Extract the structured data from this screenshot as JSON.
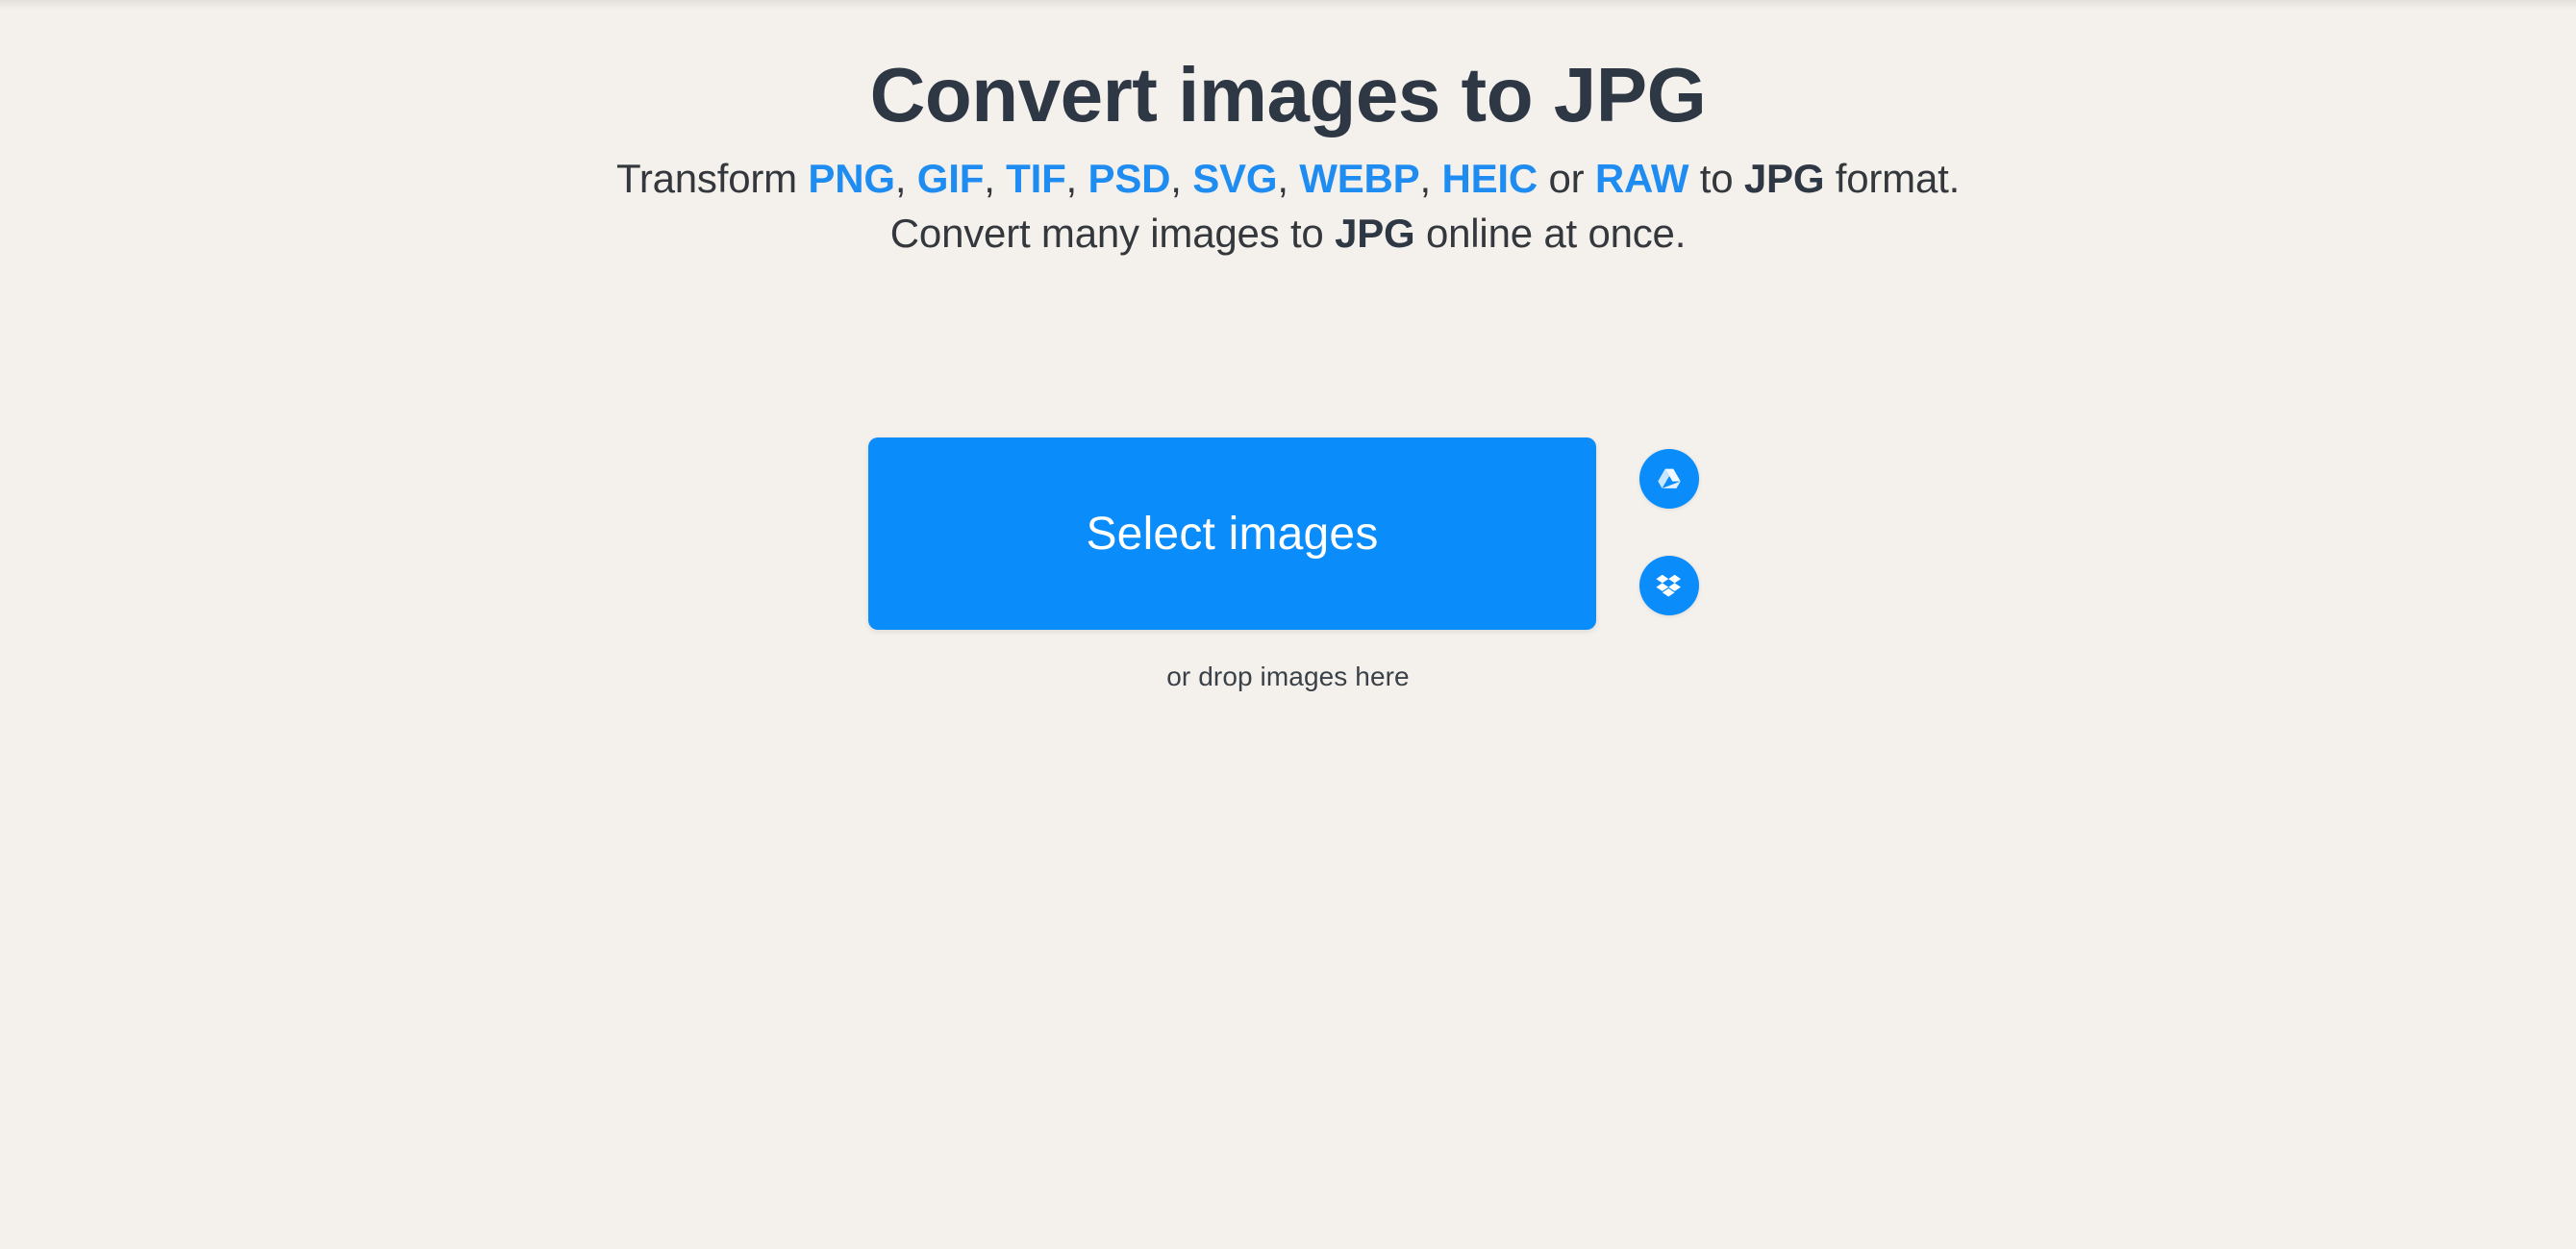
{
  "theme": {
    "background": "#F4F1ED",
    "accent_blue": "#1E8CF0",
    "button_blue": "#0A8CFA",
    "title_color": "#2E3744",
    "body_text_color": "#34383D"
  },
  "hero": {
    "title": "Convert images to JPG",
    "subtitle": {
      "line1": {
        "lead": "Transform ",
        "formats": [
          "PNG",
          "GIF",
          "TIF",
          "PSD",
          "SVG",
          "WEBP",
          "HEIC"
        ],
        "separator": ", ",
        "conjunction": " or ",
        "last_format": "RAW",
        "to_text": " to ",
        "target_format": "JPG",
        "tail": " format."
      },
      "line2": {
        "lead": "Convert many images to ",
        "target_format": "JPG",
        "tail": " online at once."
      }
    }
  },
  "actions": {
    "select_button_label": "Select images",
    "drop_hint": "or drop images here",
    "cloud_buttons": [
      {
        "id": "google-drive",
        "icon": "google-drive-icon",
        "label": "Google Drive"
      },
      {
        "id": "dropbox",
        "icon": "dropbox-icon",
        "label": "Dropbox"
      }
    ]
  }
}
